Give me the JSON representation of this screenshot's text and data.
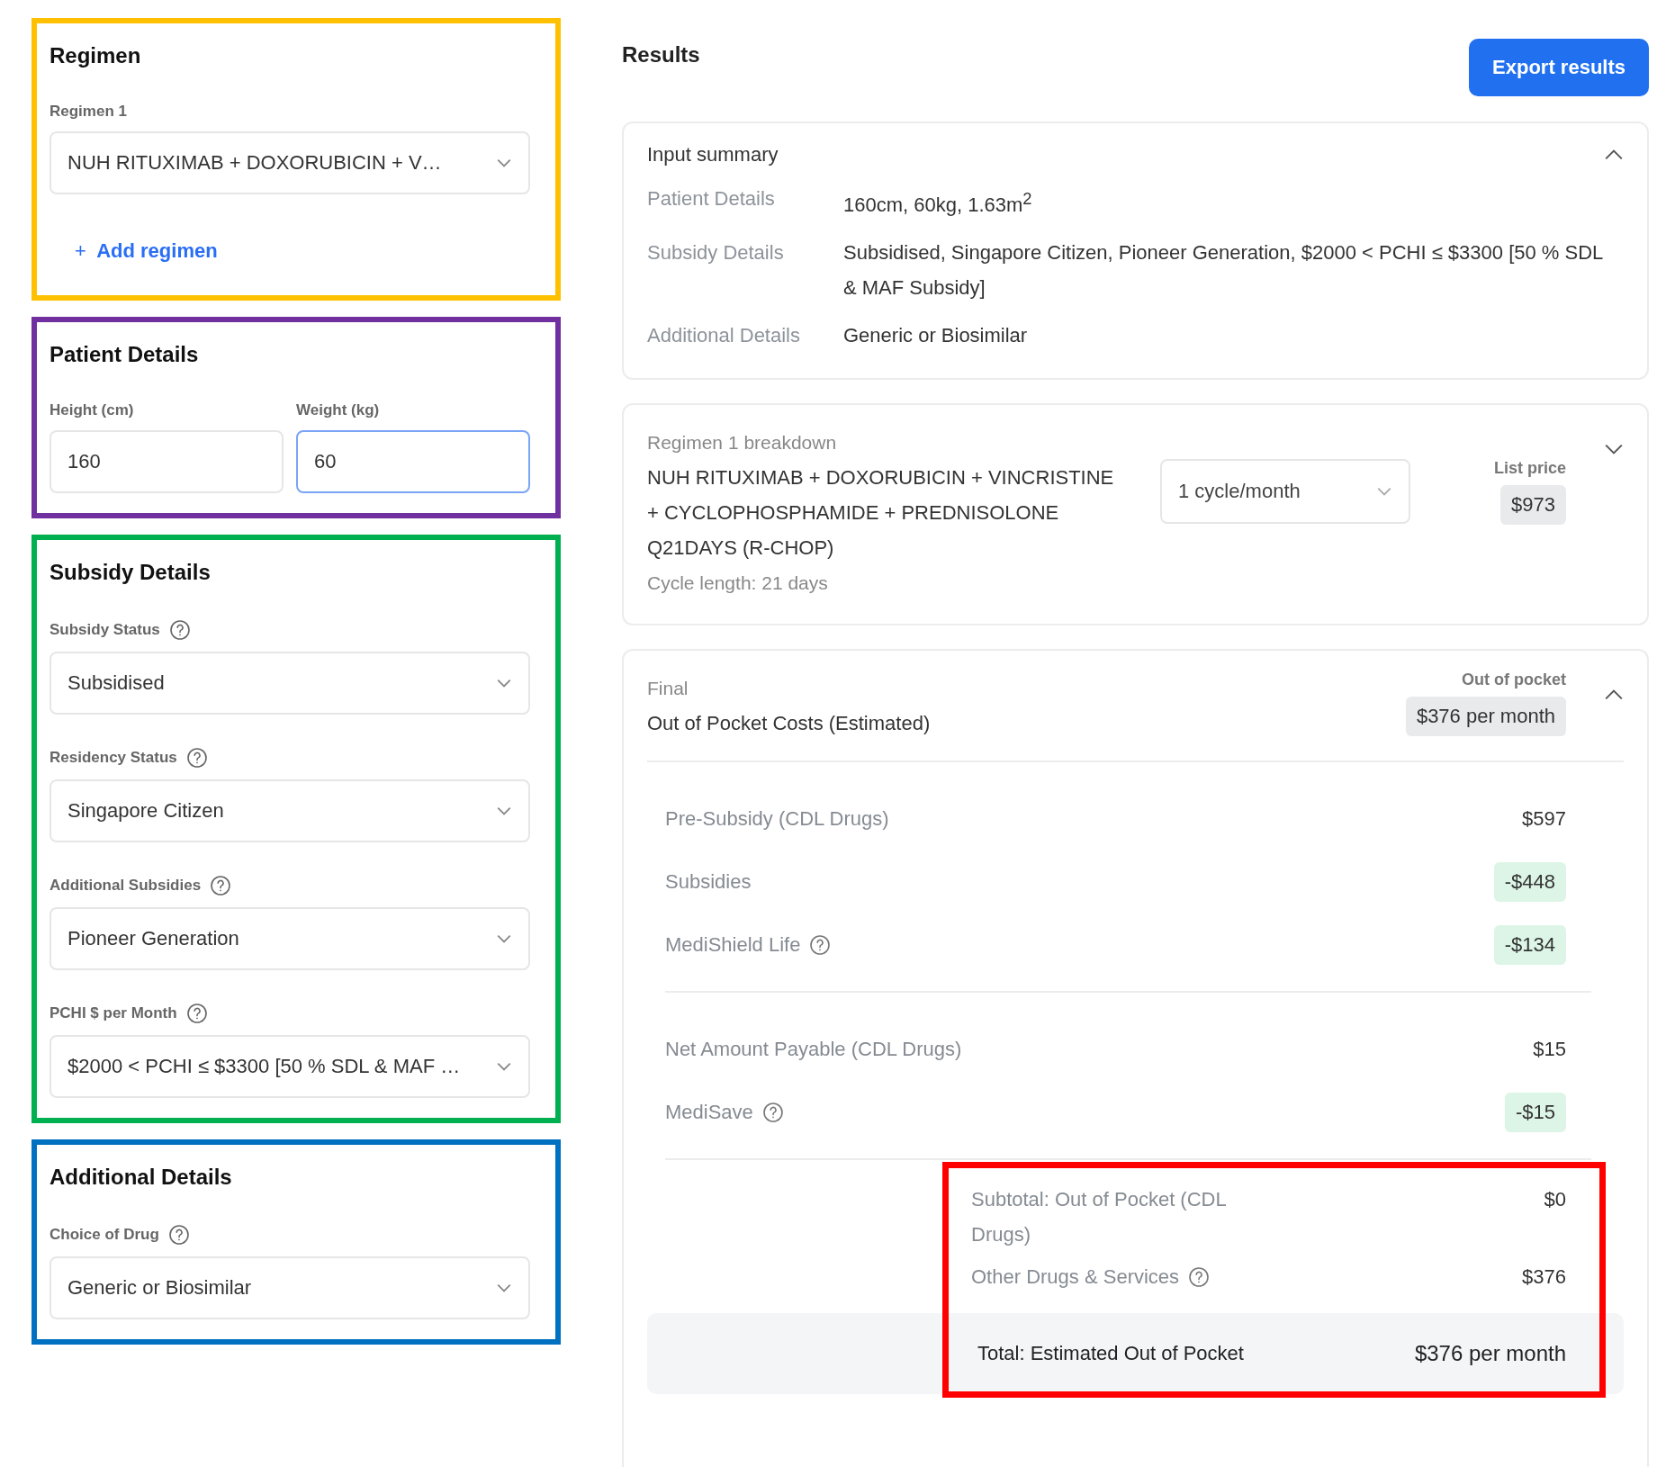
{
  "left_sections": [
    {
      "kind": "regimen",
      "title": "Regimen",
      "color": "#ffc000",
      "fields": [
        {
          "kind": "select",
          "label": "Regimen 1",
          "value": "NUH RITUXIMAB + DOXORUBICIN + V…",
          "help": false,
          "focused": false
        }
      ],
      "add_link": {
        "icon": "+",
        "label": "Add regimen"
      }
    },
    {
      "kind": "patient",
      "title": "Patient Details",
      "color": "#7030a0",
      "fields": [
        {
          "kind": "input",
          "label": "Height (cm)",
          "value": "160",
          "help": false,
          "focused": false
        },
        {
          "kind": "input",
          "label": "Weight (kg)",
          "value": "60",
          "help": false,
          "focused": true
        }
      ]
    },
    {
      "kind": "subsidy",
      "title": "Subsidy Details",
      "color": "#00b050",
      "fields": [
        {
          "kind": "select",
          "label": "Subsidy Status",
          "value": "Subsidised",
          "help": true,
          "focused": false
        },
        {
          "kind": "select",
          "label": "Residency Status",
          "value": "Singapore Citizen",
          "help": true,
          "focused": false
        },
        {
          "kind": "select",
          "label": "Additional Subsidies",
          "value": "Pioneer Generation",
          "help": true,
          "focused": false
        },
        {
          "kind": "select",
          "label": "PCHI $ per Month",
          "value": "$2000 < PCHI ≤ $3300 [50 % SDL & MAF …",
          "help": true,
          "focused": false
        }
      ]
    },
    {
      "kind": "additional",
      "title": "Additional Details",
      "color": "#0070c0",
      "fields": [
        {
          "kind": "select",
          "label": "Choice of Drug",
          "value": "Generic or Biosimilar",
          "help": true,
          "focused": false
        }
      ]
    }
  ],
  "results": {
    "title": "Results",
    "export_button": "Export results",
    "input_summary": {
      "title": "Input summary",
      "expanded": true,
      "rows": [
        {
          "label": "Patient Details",
          "value": "160cm, 60kg, 1.63m$^{2}$"
        },
        {
          "label": "Subsidy Details",
          "value": "Subsidised, Singapore Citizen, Pioneer Generation, $2000 < PCHI ≤ $3300 [50 % SDL & MAF Subsidy]"
        },
        {
          "label": "Additional Details",
          "value": "Generic or Biosimilar"
        }
      ]
    },
    "breakdown": {
      "caption": "Regimen 1 breakdown",
      "name": "NUH RITUXIMAB + DOXORUBICIN + VINCRISTINE + CYCLOPHOSPHAMIDE + PREDNISOLONE Q21DAYS (R-CHOP)",
      "cycle_length": "Cycle length: 21 days",
      "frequency": "1 cycle/month",
      "price_label": "List price",
      "price": "$973",
      "expanded": false
    },
    "final": {
      "caption": "Final",
      "title": "Out of Pocket Costs (Estimated)",
      "amount_label": "Out of pocket",
      "amount": "$376 per month",
      "expanded": true,
      "groups": [
        [
          {
            "kind": "plain",
            "label": "Pre-Subsidy (CDL Drugs)",
            "value": "$597",
            "help": false
          },
          {
            "kind": "deduction",
            "label": "Subsidies",
            "value": "-$448",
            "help": false
          },
          {
            "kind": "deduction",
            "label": "MediShield Life",
            "value": "-$134",
            "help": true
          }
        ],
        [
          {
            "kind": "plain",
            "label": "Net Amount Payable (CDL Drugs)",
            "value": "$15",
            "help": false
          },
          {
            "kind": "deduction",
            "label": "MediSave",
            "value": "-$15",
            "help": true
          }
        ]
      ],
      "subtotals": [
        {
          "label": "Subtotal: Out of Pocket (CDL Drugs)",
          "value": "$0",
          "help": false
        },
        {
          "label": "Other Drugs & Services",
          "value": "$376",
          "help": true
        }
      ],
      "total": {
        "label": "Total: Estimated Out of Pocket",
        "value": "$376 per month"
      },
      "highlight": {
        "color": "#ff0000"
      }
    }
  }
}
